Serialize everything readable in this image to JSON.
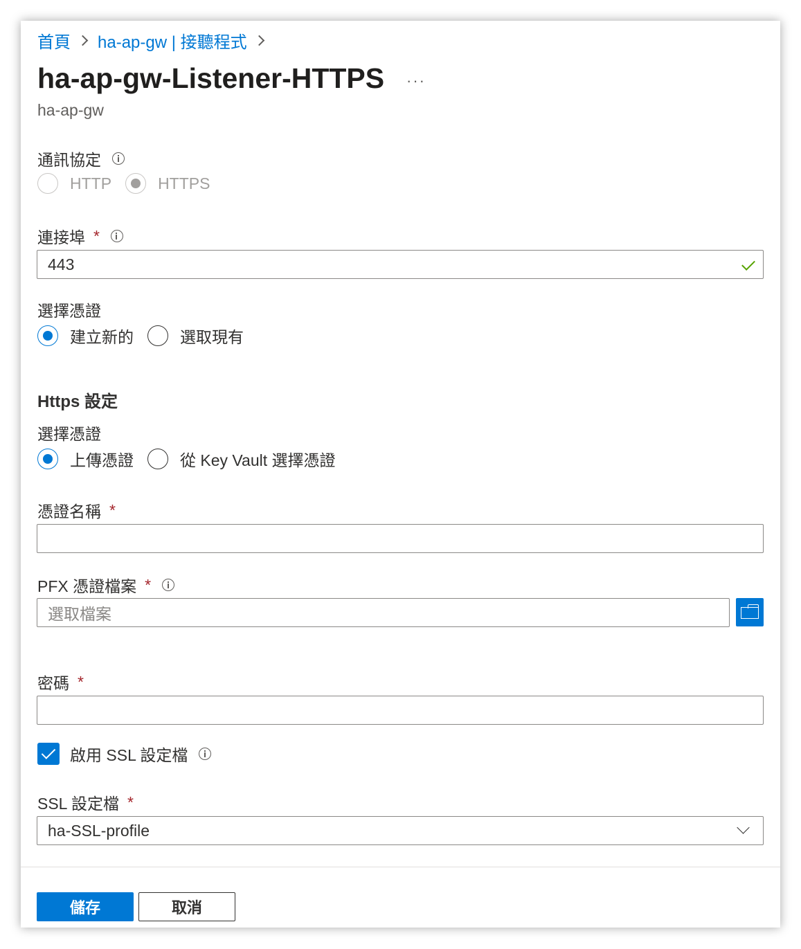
{
  "breadcrumb": {
    "home": "首頁",
    "parent": "ha-ap-gw | 接聽程式"
  },
  "header": {
    "title": "ha-ap-gw-Listener-HTTPS",
    "more": "···",
    "subtitle": "ha-ap-gw"
  },
  "protocol": {
    "label": "通訊協定",
    "options": [
      "HTTP",
      "HTTPS"
    ],
    "selected": "HTTPS",
    "disabled": true
  },
  "port": {
    "label": "連接埠",
    "required_mark": "*",
    "value": "443",
    "valid": true
  },
  "certificate_choice": {
    "label": "選擇憑證",
    "options": [
      "建立新的",
      "選取現有"
    ],
    "selected": "建立新的"
  },
  "https_settings": {
    "title": "Https 設定",
    "cert_source": {
      "label": "選擇憑證",
      "options": [
        "上傳憑證",
        "從 Key Vault 選擇憑證"
      ],
      "selected": "上傳憑證"
    },
    "cert_name": {
      "label": "憑證名稱",
      "required_mark": "*",
      "value": ""
    },
    "pfx_file": {
      "label": "PFX 憑證檔案",
      "required_mark": "*",
      "placeholder": "選取檔案"
    },
    "password": {
      "label": "密碼",
      "required_mark": "*",
      "value": ""
    },
    "enable_ssl_profile": {
      "label": "啟用 SSL 設定檔",
      "checked": true
    },
    "ssl_profile": {
      "label": "SSL 設定檔",
      "required_mark": "*",
      "value": "ha-SSL-profile"
    }
  },
  "footer": {
    "save": "儲存",
    "cancel": "取消"
  },
  "colors": {
    "accent": "#0078d4",
    "required": "#a4262c",
    "valid": "#57a300"
  }
}
